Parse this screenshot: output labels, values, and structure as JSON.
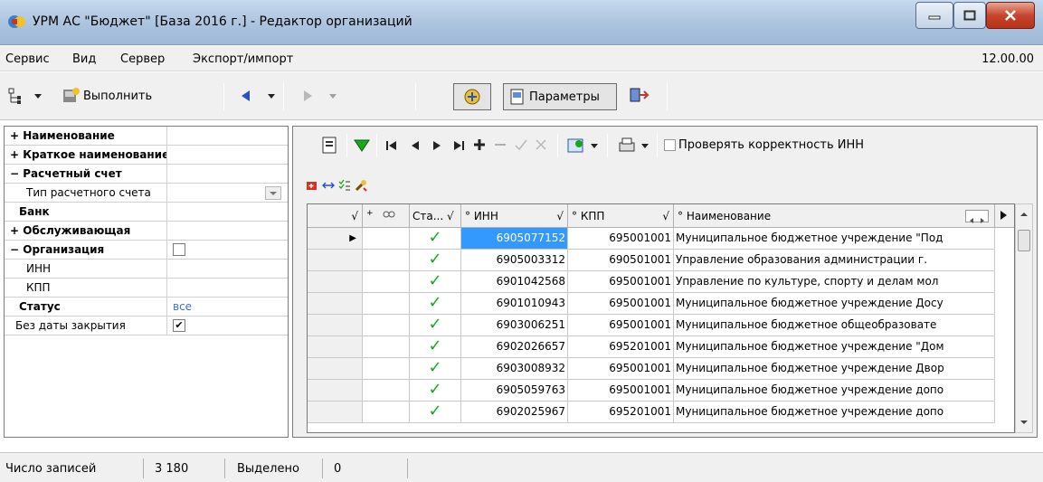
{
  "window": {
    "title": "УРМ АС \"Бюджет\" [База 2016 г.] - Редактор организаций",
    "version": "12.00.00"
  },
  "menu": [
    "Сервис",
    "Вид",
    "Сервер",
    "Экспорт/импорт"
  ],
  "toolbar": {
    "execute_label": "Выполнить",
    "params_label": "Параметры"
  },
  "filter_panel": {
    "rows": [
      {
        "label": "Наименование",
        "prefix": "+"
      },
      {
        "label": "Краткое наименование",
        "prefix": "+"
      },
      {
        "label": "Расчетный счет",
        "prefix": "−"
      },
      {
        "label": "Тип расчетного счета",
        "prefix": ""
      },
      {
        "label": "Банк",
        "prefix": ""
      },
      {
        "label": "Обслуживающая",
        "prefix": "+"
      },
      {
        "label": "Организация",
        "prefix": "−"
      },
      {
        "label": "ИНН",
        "prefix": ""
      },
      {
        "label": "КПП",
        "prefix": ""
      },
      {
        "label": "Статус",
        "prefix": ""
      },
      {
        "label": "Без даты закрытия",
        "prefix": ""
      }
    ],
    "status_value": "все",
    "org_checked": false,
    "no_close_date_checked": true
  },
  "grid_toolbar": {
    "check_inn_label": "Проверять корректность ИНН"
  },
  "grid": {
    "columns": [
      "Ста...",
      "ИНН",
      "КПП",
      "Наименование"
    ],
    "rows": [
      {
        "inn": "6905077152",
        "kpp": "695001001",
        "name": "Муниципальное бюджетное учреждение \"Под"
      },
      {
        "inn": "6905003312",
        "kpp": "690501001",
        "name": "Управление образования администрации г. "
      },
      {
        "inn": "6901042568",
        "kpp": "695001001",
        "name": "Управление по культуре, спорту и делам мол"
      },
      {
        "inn": "6901010943",
        "kpp": "695001001",
        "name": "Муниципальное бюджетное учреждение Досу"
      },
      {
        "inn": "6903006251",
        "kpp": "695001001",
        "name": "Муниципальное бюджетное общеобразовате"
      },
      {
        "inn": "6902026657",
        "kpp": "695201001",
        "name": "Муниципальное бюджетное учреждение \"Дом"
      },
      {
        "inn": "6903008932",
        "kpp": "695001001",
        "name": "Муниципальное бюджетное учреждение  Двор"
      },
      {
        "inn": "6905059763",
        "kpp": "695001001",
        "name": "Муниципальное бюджетное учреждение допо"
      },
      {
        "inn": "6902025967",
        "kpp": "695201001",
        "name": "Муниципальное бюджетное учреждение допо"
      }
    ]
  },
  "status": {
    "count_label": "Число записей",
    "count_value": "3 180",
    "selected_label": "Выделено",
    "selected_value": "0"
  },
  "colors": {
    "selection": "#3399ff",
    "check_green": "#18a818",
    "status_value_blue": "#3c6fd1"
  }
}
